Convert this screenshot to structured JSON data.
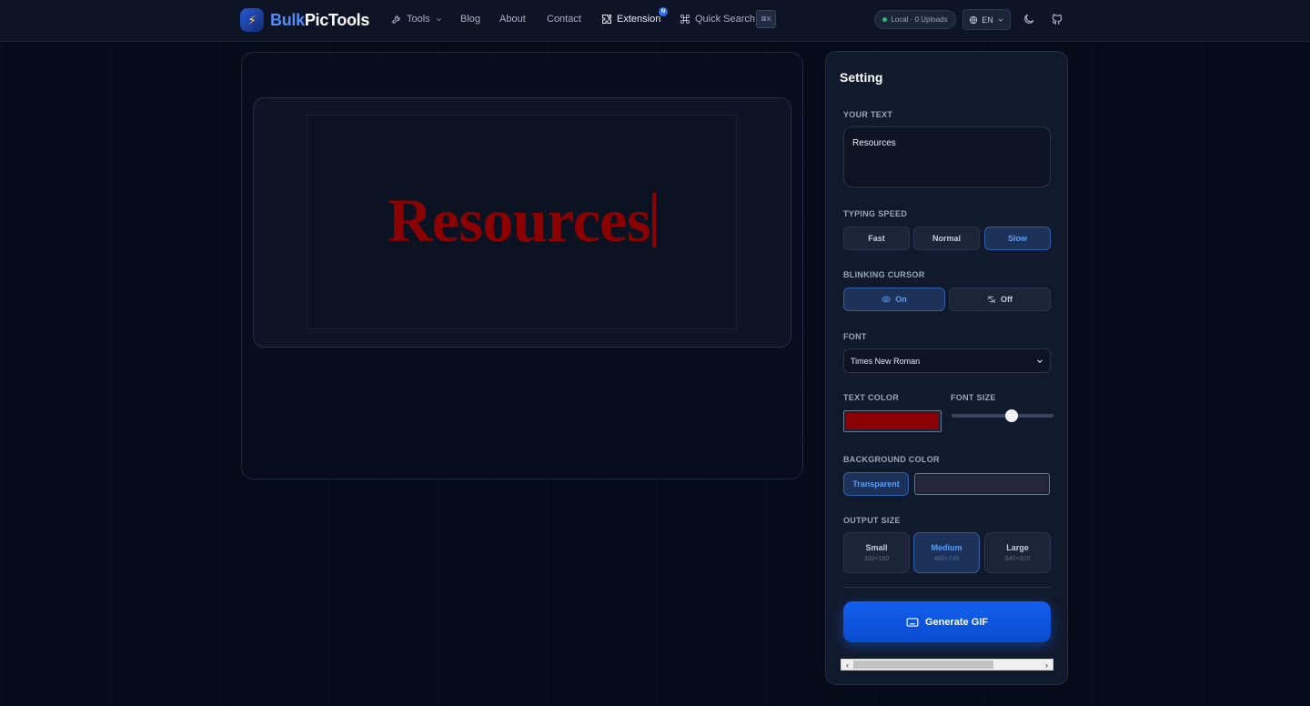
{
  "nav": {
    "logo_part1": "Bulk",
    "logo_part2": "PicTools",
    "tools": "Tools",
    "blog": "Blog",
    "about": "About",
    "contact": "Contact",
    "extension": "Extension",
    "extension_badge": "N",
    "quick_search": "Quick Search",
    "shortcut": "⌘K",
    "local_status": "Local · 0 Uploads",
    "language": "EN"
  },
  "preview": {
    "text": "Resources",
    "text_color": "#8b0000"
  },
  "settings": {
    "title": "Setting",
    "your_text_label": "YOUR TEXT",
    "your_text_value": "Resources",
    "typing_speed_label": "TYPING SPEED",
    "typing_speeds": [
      "Fast",
      "Normal",
      "Slow"
    ],
    "typing_speed_selected": "Slow",
    "blinking_cursor_label": "BLINKING CURSOR",
    "cursor_on": "On",
    "cursor_off": "Off",
    "cursor_selected": "On",
    "font_label": "FONT",
    "font_value": "Times New Roman",
    "text_color_label": "TEXT COLOR",
    "text_color": "#8b0000",
    "font_size_label": "FONT SIZE",
    "font_size_fraction": 0.6,
    "background_color_label": "BACKGROUND COLOR",
    "transparent_label": "Transparent",
    "background_color": "#26263a",
    "output_size_label": "OUTPUT SIZE",
    "output_sizes": [
      {
        "name": "Small",
        "dims": "320×160"
      },
      {
        "name": "Medium",
        "dims": "480×240"
      },
      {
        "name": "Large",
        "dims": "640×320"
      }
    ],
    "output_size_selected": "Medium",
    "generate_label": "Generate GIF"
  },
  "colors": {
    "accent": "#1260f0",
    "active_text": "#5d9cf7"
  }
}
